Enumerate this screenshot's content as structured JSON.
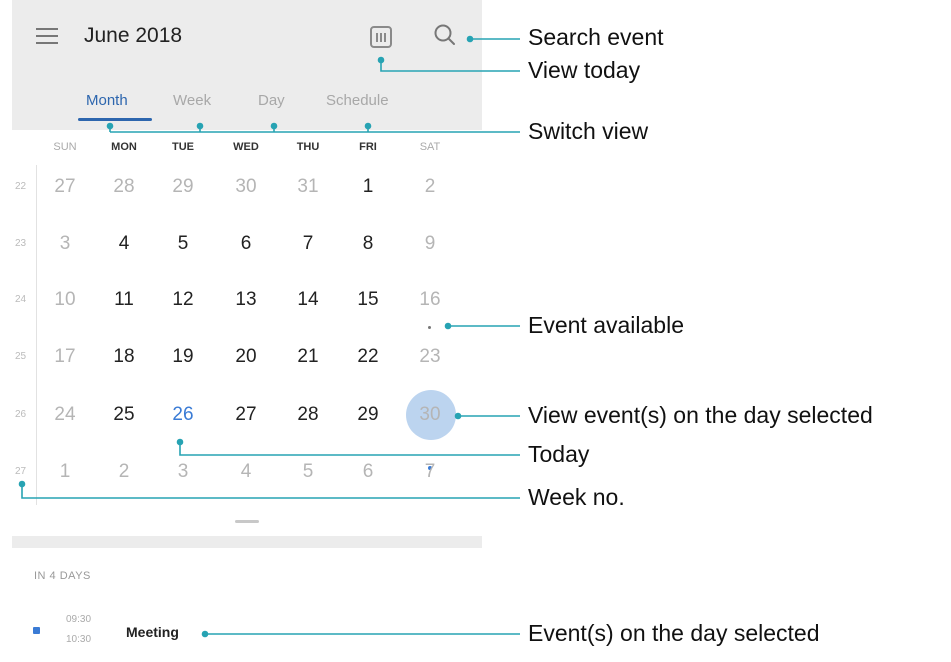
{
  "header": {
    "title": "June 2018",
    "menu_icon": "hamburger-menu-icon",
    "today_icon": "calendar-today-icon",
    "search_icon": "search-icon"
  },
  "tabs": [
    {
      "label": "Month",
      "active": true
    },
    {
      "label": "Week",
      "active": false
    },
    {
      "label": "Day",
      "active": false
    },
    {
      "label": "Schedule",
      "active": false
    }
  ],
  "weekdays": [
    "SUN",
    "MON",
    "TUE",
    "WED",
    "THU",
    "FRI",
    "SAT"
  ],
  "weeks": [
    {
      "no": "22",
      "days": [
        "27",
        "28",
        "29",
        "30",
        "31",
        "1",
        "2"
      ]
    },
    {
      "no": "23",
      "days": [
        "3",
        "4",
        "5",
        "6",
        "7",
        "8",
        "9"
      ]
    },
    {
      "no": "24",
      "days": [
        "10",
        "11",
        "12",
        "13",
        "14",
        "15",
        "16"
      ]
    },
    {
      "no": "25",
      "days": [
        "17",
        "18",
        "19",
        "20",
        "21",
        "22",
        "23"
      ]
    },
    {
      "no": "26",
      "days": [
        "24",
        "25",
        "26",
        "27",
        "28",
        "29",
        "30"
      ]
    },
    {
      "no": "27",
      "days": [
        "1",
        "2",
        "3",
        "4",
        "5",
        "6",
        "7"
      ]
    }
  ],
  "today": "26",
  "selected_day": "30",
  "upcoming": {
    "section_label": "IN 4 DAYS",
    "event": {
      "start": "09:30",
      "end": "10:30",
      "title": "Meeting"
    }
  },
  "callouts": {
    "search": "Search event",
    "today": "View today",
    "switch": "Switch view",
    "event_available": "Event available",
    "view_selected": "View event(s) on the day selected",
    "today_label": "Today",
    "week_no": "Week no.",
    "events_selected": "Event(s) on the day selected"
  },
  "colors": {
    "accent": "#2d66ae",
    "today": "#3a7bd5",
    "selected_bg": "#bcd4ef",
    "callout_line": "#27a3b3"
  }
}
